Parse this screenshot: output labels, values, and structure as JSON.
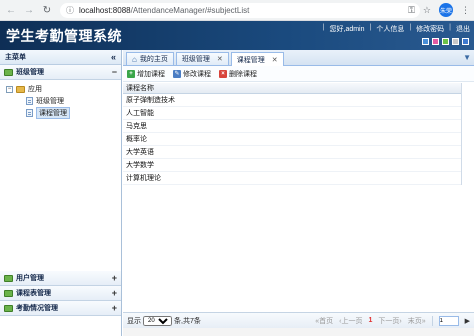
{
  "browser": {
    "url_host": "localhost:8088",
    "url_path": "/AttendanceManager/#subjectList",
    "profile_label": "朱荣"
  },
  "header": {
    "title": "学生考勤管理系统",
    "greeting": "您好,admin",
    "links": [
      "个人信息",
      "修改密码",
      "退出"
    ],
    "theme_colors": [
      "#4a90d9",
      "#e35ba4",
      "#6cc24a",
      "#c8c8c8",
      "#3e7ad0"
    ]
  },
  "sidebar": {
    "title": "主菜单",
    "collapse_icon": "double-chevron-left-icon",
    "expanded_section": {
      "label": "班级管理",
      "toggle": "−",
      "tree": {
        "root": "应用",
        "children": [
          "班级管理",
          "课程管理"
        ],
        "selected": "课程管理"
      }
    },
    "collapsed_sections": [
      {
        "label": "用户管理",
        "toggle": "+"
      },
      {
        "label": "课程表管理",
        "toggle": "+"
      },
      {
        "label": "考勤情况管理",
        "toggle": "+"
      }
    ]
  },
  "tabs": [
    {
      "label": "我的主页",
      "icon": "home-icon",
      "closable": false
    },
    {
      "label": "班级管理",
      "closable": true
    },
    {
      "label": "课程管理",
      "closable": true,
      "active": true
    }
  ],
  "toolbar": {
    "add_label": "增加课程",
    "edit_label": "修改课程",
    "delete_label": "删除课程"
  },
  "grid": {
    "column_header": "课程名称",
    "rows": [
      "原子弹制造技术",
      "人工智能",
      "马克思",
      "概率论",
      "大学英语",
      "大学数学",
      "计算机理论"
    ]
  },
  "pager": {
    "show_label": "显示",
    "page_size": "20",
    "per_page_suffix": "条,共7条",
    "first": "首页",
    "prev": "上一页",
    "current": "1",
    "next": "下一页",
    "last": "末页",
    "jump_value": "1"
  }
}
